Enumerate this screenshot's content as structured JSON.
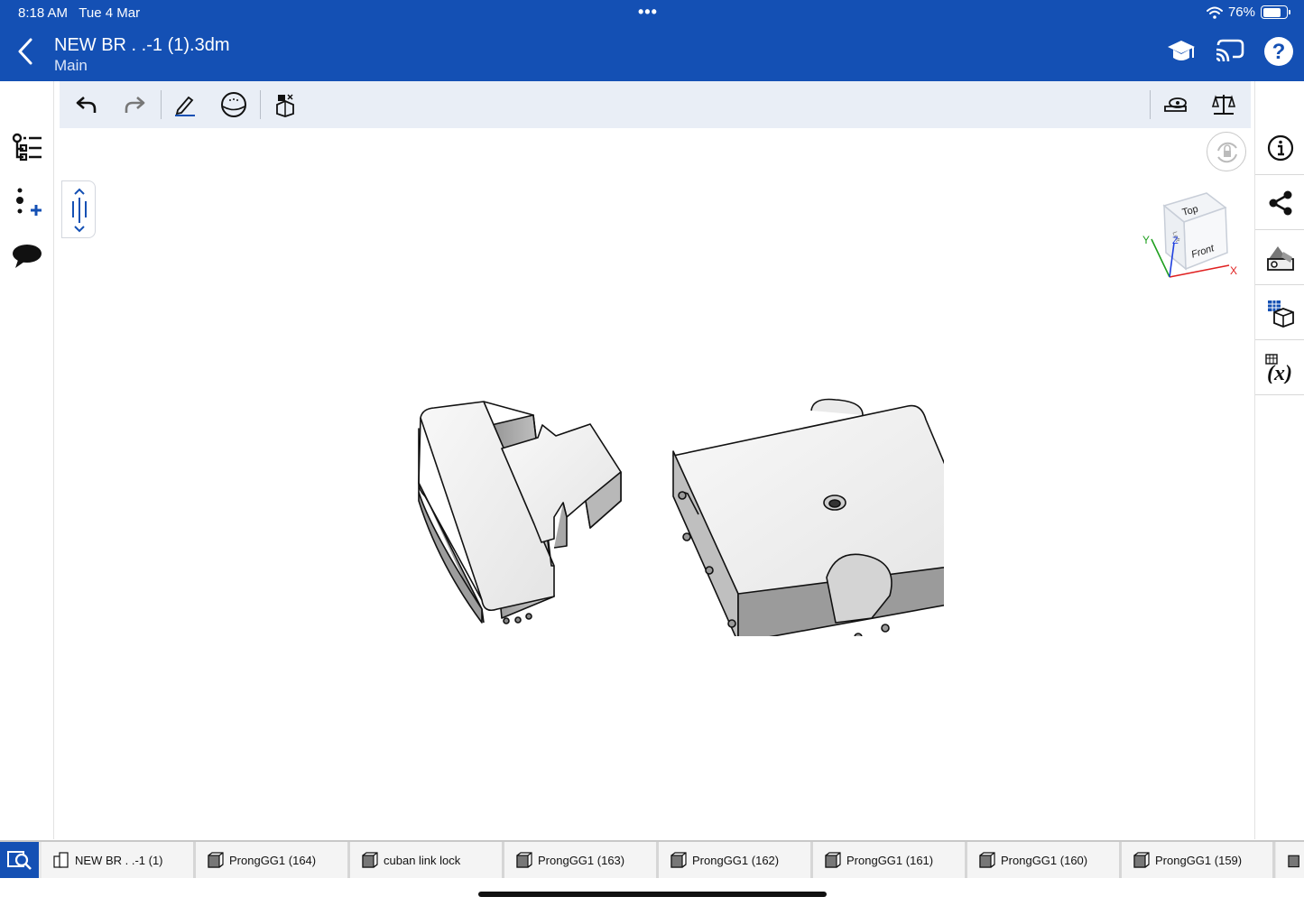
{
  "status_bar": {
    "time": "8:18 AM",
    "date": "Tue 4 Mar",
    "battery": "76%",
    "battery_level": 0.76
  },
  "header": {
    "title": "NEW BR . .-1 (1).3dm",
    "subtitle": "Main"
  },
  "viewcube": {
    "top": "Top",
    "front": "Front",
    "left": "Left",
    "axis_x": "X",
    "axis_y": "Y",
    "axis_z": "Z"
  },
  "tabs": [
    {
      "label": "NEW BR . .-1 (1)",
      "icon": "assembly-icon"
    },
    {
      "label": "ProngGG1 (164)",
      "icon": "part-icon"
    },
    {
      "label": "cuban link lock",
      "icon": "part-icon"
    },
    {
      "label": "ProngGG1 (163)",
      "icon": "part-icon"
    },
    {
      "label": "ProngGG1 (162)",
      "icon": "part-icon"
    },
    {
      "label": "ProngGG1 (161)",
      "icon": "part-icon"
    },
    {
      "label": "ProngGG1 (160)",
      "icon": "part-icon"
    },
    {
      "label": "ProngGG1 (159)",
      "icon": "part-icon"
    }
  ],
  "colors": {
    "brand": "#1450b4",
    "toolbar": "#e9eef6",
    "axis_x": "#e02020",
    "axis_y": "#20a020",
    "axis_z": "#2040e0"
  }
}
